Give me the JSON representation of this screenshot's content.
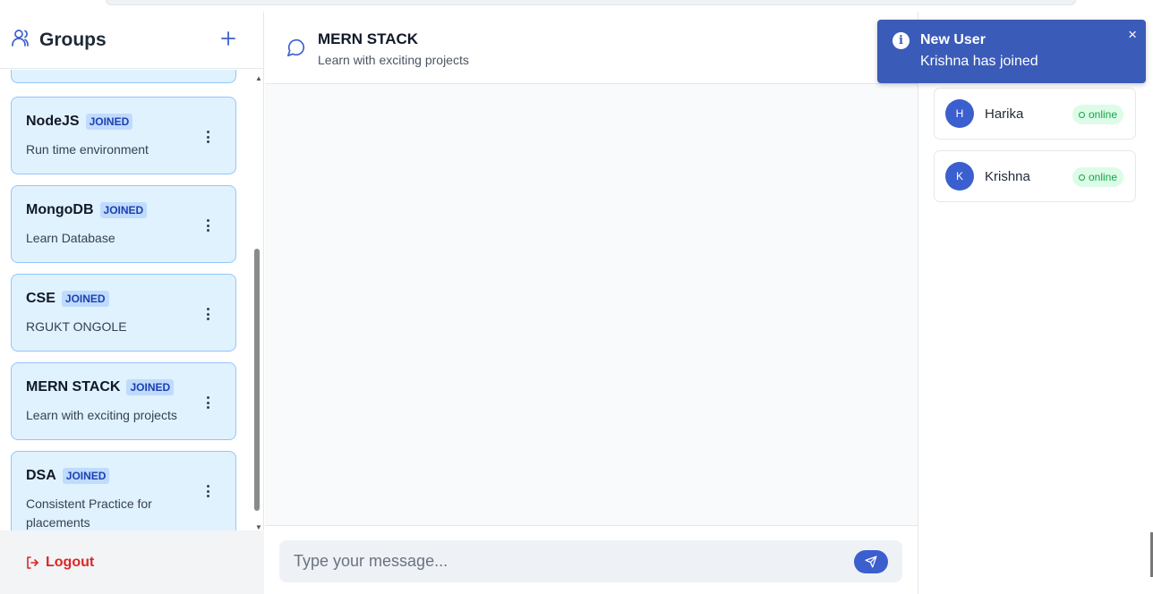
{
  "sidebar": {
    "title": "Groups",
    "add_symbol": "+",
    "groups": [
      {
        "name": "NodeJS",
        "badge": "JOINED",
        "description": "Run time environment"
      },
      {
        "name": "MongoDB",
        "badge": "JOINED",
        "description": "Learn Database"
      },
      {
        "name": "CSE",
        "badge": "JOINED",
        "description": "RGUKT ONGOLE"
      },
      {
        "name": "MERN STACK",
        "badge": "JOINED",
        "description": "Learn with exciting projects"
      },
      {
        "name": "DSA",
        "badge": "JOINED",
        "description": "Consistent Practice for placements"
      }
    ],
    "logout_label": "Logout"
  },
  "chat": {
    "title": "MERN STACK",
    "subtitle": "Learn with exciting projects",
    "input_placeholder": "Type your message..."
  },
  "members": [
    {
      "initial": "H",
      "name": "Harika",
      "status": "online"
    },
    {
      "initial": "K",
      "name": "Krishna",
      "status": "online"
    }
  ],
  "toast": {
    "title": "New User",
    "message": "Krishna has joined",
    "close_symbol": "×",
    "info_symbol": "i"
  },
  "colors": {
    "accent": "#3b5fce",
    "card_bg": "#e0f2fe",
    "logout": "#dc2626",
    "online": "#16a34a",
    "toast_bg": "#3b5bb8"
  }
}
